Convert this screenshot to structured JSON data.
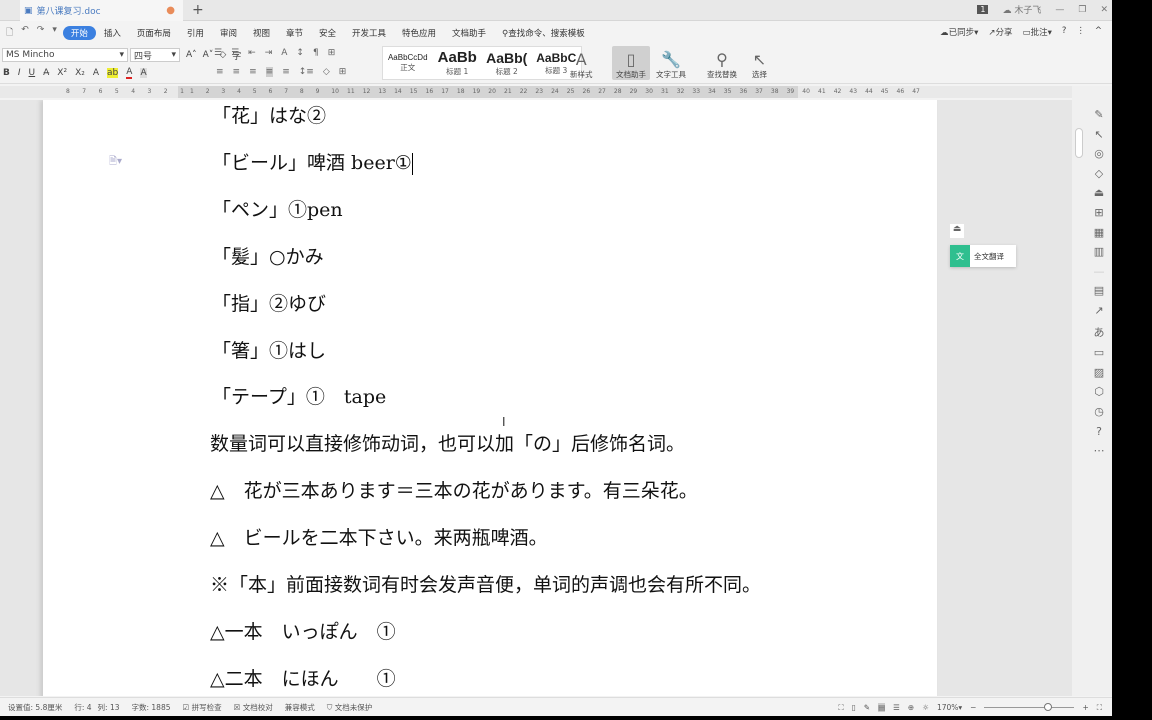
{
  "tabbar": {
    "doc_name": "第八课复习.doc",
    "new_tab": "+",
    "badge": "1",
    "user": "木子飞",
    "minimize": "—",
    "restore": "❐",
    "close": "✕"
  },
  "menu": {
    "items": [
      "开始",
      "插入",
      "页面布局",
      "引用",
      "审阅",
      "视图",
      "章节",
      "安全",
      "开发工具",
      "特色应用",
      "文档助手"
    ],
    "search": "查找命令、搜索模板",
    "sync": "已同步",
    "share": "分享",
    "comment": "批注",
    "help": "?",
    "more": "⋮",
    "collapse": "^"
  },
  "toolbar": {
    "font": "MS Mincho",
    "size": "四号",
    "styles": [
      {
        "sample": "AaBbCcDd",
        "label": "正文"
      },
      {
        "sample": "AaBb",
        "label": "标题 1"
      },
      {
        "sample": "AaBb(",
        "label": "标题 2"
      },
      {
        "sample": "AaBbC",
        "label": "标题 3"
      }
    ],
    "new_style": "新样式",
    "doc_assistant": "文档助手",
    "text_tools": "文字工具",
    "find_replace": "查找替换",
    "select": "选择"
  },
  "ruler": {
    "left": [
      "8",
      "7",
      "6",
      "5",
      "4",
      "3",
      "2",
      "1"
    ],
    "right": [
      "1",
      "2",
      "3",
      "4",
      "5",
      "6",
      "7",
      "8",
      "9",
      "10",
      "11",
      "12",
      "13",
      "14",
      "15",
      "16",
      "17",
      "18",
      "19",
      "20",
      "21",
      "22",
      "23",
      "24",
      "25",
      "26",
      "27",
      "28",
      "29",
      "30",
      "31",
      "32",
      "33",
      "34",
      "35",
      "36",
      "37",
      "38",
      "39",
      "40",
      "41",
      "42",
      "43",
      "44",
      "45",
      "46",
      "47"
    ]
  },
  "document": {
    "lines": [
      "「花」はな②",
      "「ビール」啤酒 beer①",
      "「ペン」①pen",
      "「髪」○かみ",
      "「指」②ゆび",
      "「箸」①はし",
      "「テープ」①　tape",
      "数量词可以直接修饰动词，也可以加「の」后修饰名词。",
      "△　花が三本あります＝三本の花があります。有三朵花。",
      "△　ビールを二本下さい。来两瓶啤酒。",
      "※「本」前面接数词有时会发声音便，单词的声调也会有所不同。",
      "△一本　いっぽん　①",
      "△二本　にほん　　①"
    ]
  },
  "side": {
    "translate": "全文翻译"
  },
  "status": {
    "setting": "设置值: 5.8厘米",
    "row": "行: 4",
    "col": "列: 13",
    "words": "字数: 1885",
    "spell": "拼写检查",
    "proof": "文档校对",
    "compat": "兼容模式",
    "protect": "文档未保护",
    "zoom": "170%"
  }
}
